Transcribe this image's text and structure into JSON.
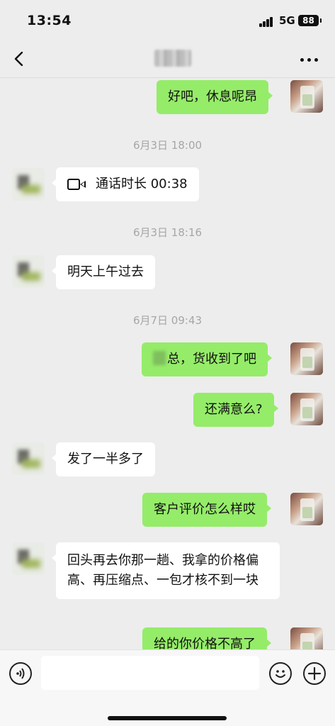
{
  "status_bar": {
    "time": "13:54",
    "network": "5G",
    "battery": "88"
  },
  "nav": {
    "back_icon": "chevron-left-icon",
    "more_icon": "more-dots-icon"
  },
  "chat": {
    "messages": [
      {
        "from": "me",
        "text": "好吧，休息呢昂"
      },
      {
        "type": "timestamp",
        "text": "6月3日 18:00"
      },
      {
        "from": "them",
        "type": "call",
        "icon": "video-call-icon",
        "text": "通话时长 00:38"
      },
      {
        "type": "timestamp",
        "text": "6月3日 18:16"
      },
      {
        "from": "them",
        "text": "明天上午过去"
      },
      {
        "type": "timestamp",
        "text": "6月7日 09:43"
      },
      {
        "from": "me",
        "text": "总，货收到了吧"
      },
      {
        "from": "me",
        "text": "还满意么?"
      },
      {
        "from": "them",
        "text": "发了一半多了"
      },
      {
        "from": "me",
        "text": "客户评价怎么样哎"
      },
      {
        "from": "them",
        "text": "回头再去你那一趟、我拿的价格偏高、再压缩点、一包才核不到一块"
      },
      {
        "from": "me",
        "text": "给的你价格不高了"
      }
    ]
  },
  "input_bar": {
    "voice_icon": "voice-icon",
    "emoji_icon": "emoji-icon",
    "plus_icon": "plus-icon"
  },
  "colors": {
    "background": "#ededed",
    "my_bubble": "#95ec69",
    "their_bubble": "#ffffff",
    "timestamp": "#a6a6a6"
  }
}
